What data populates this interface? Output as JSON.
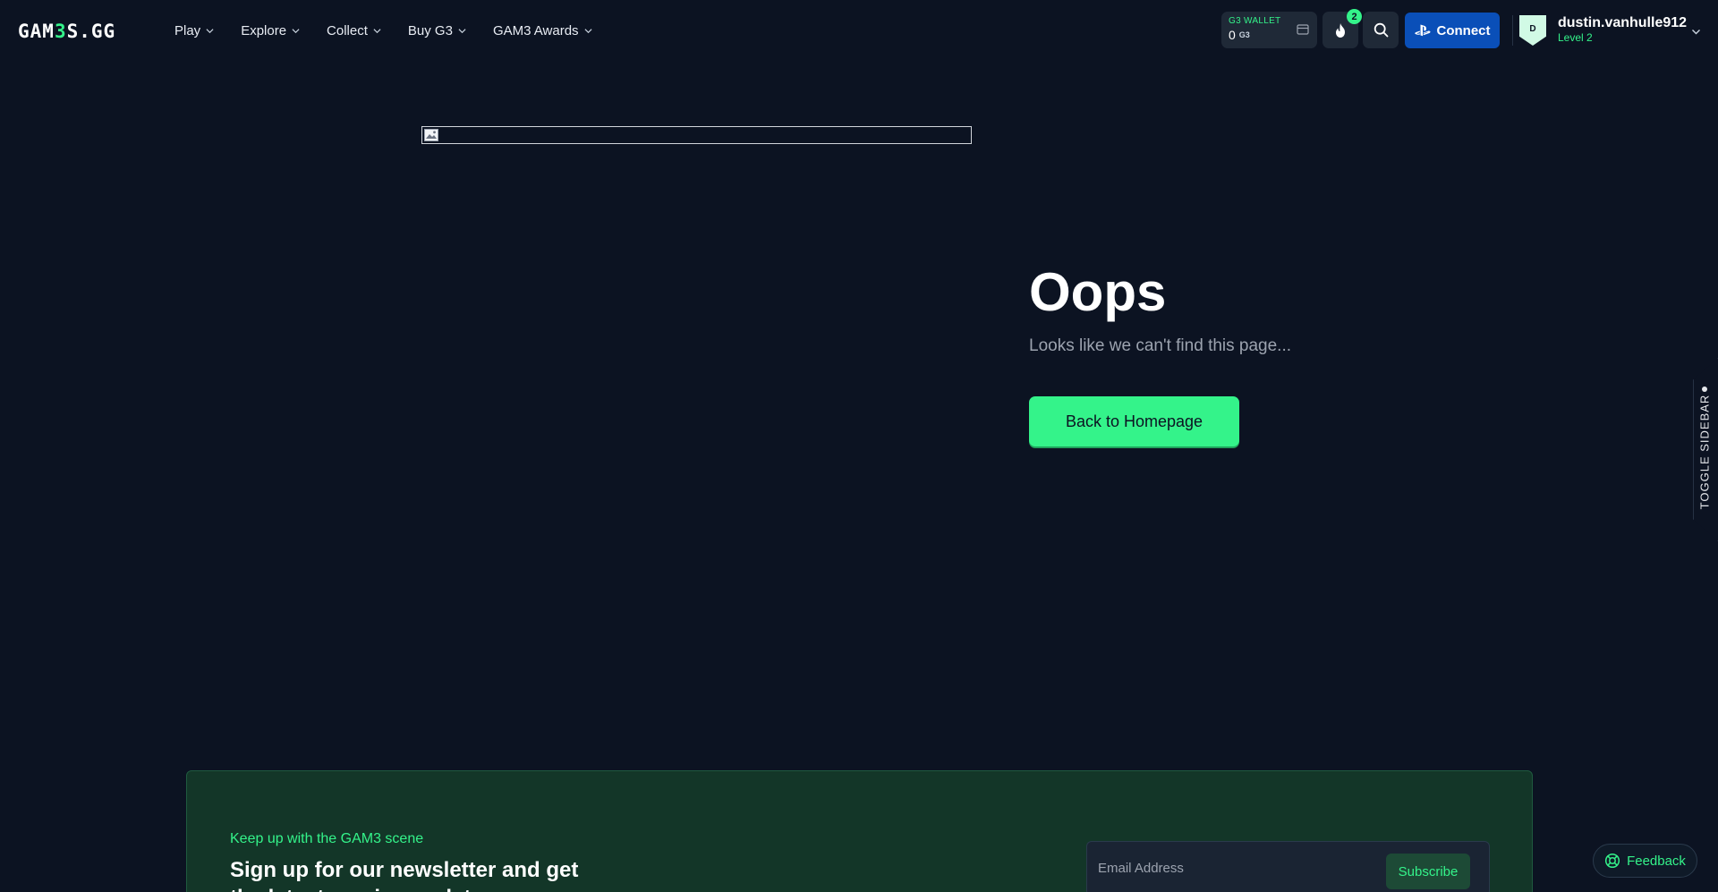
{
  "header": {
    "logo": {
      "part1": "GAM",
      "part2": "3",
      "part3": "S.GG"
    },
    "nav": [
      {
        "label": "Play"
      },
      {
        "label": "Explore"
      },
      {
        "label": "Collect"
      },
      {
        "label": "Buy G3"
      },
      {
        "label": "GAM3 Awards"
      }
    ],
    "wallet": {
      "label": "G3 WALLET",
      "amount": "0",
      "currency_mark": "G3"
    },
    "streak": {
      "count": "2"
    },
    "connect_label": "Connect",
    "user": {
      "initial": "D",
      "name": "dustin.vanhulle912",
      "level": "Level 2"
    }
  },
  "main": {
    "title": "Oops",
    "subtitle": "Looks like we can't find this page...",
    "home_button": "Back to Homepage"
  },
  "sidebar_toggle": {
    "label": "TOGGLE SIDEBAR"
  },
  "newsletter": {
    "kicker": "Keep up with the GAM3 scene",
    "heading": "Sign up for our newsletter and get the latest gaming updates",
    "email_placeholder": "Email Address",
    "subscribe_label": "Subscribe"
  },
  "feedback_label": "Feedback",
  "colors": {
    "background": "#0c1322",
    "accent": "#34f38a",
    "connect": "#0a4fb8",
    "newsletter_bg": "#133628"
  }
}
